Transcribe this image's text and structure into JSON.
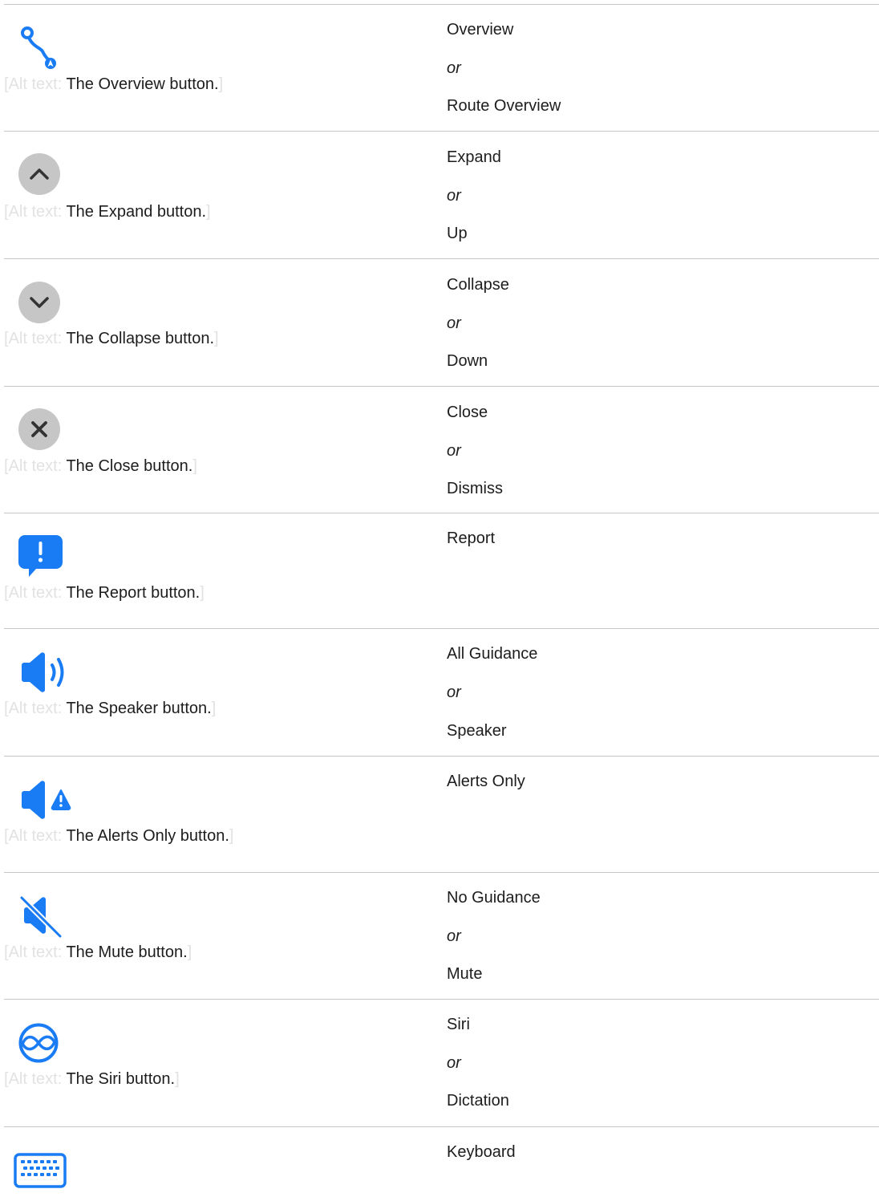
{
  "alt_prefix": "Alt text:",
  "alt_open": "[",
  "alt_close": "]",
  "or_word": "or",
  "accent_color": "#1a7cf4",
  "rows": [
    {
      "icon": "route-overview-icon",
      "alt": "The Overview button.",
      "names": [
        "Overview",
        "Route Overview"
      ]
    },
    {
      "icon": "chevron-up-circle-icon",
      "alt": "The Expand button.",
      "names": [
        "Expand",
        "Up"
      ]
    },
    {
      "icon": "chevron-down-circle-icon",
      "alt": "The Collapse button.",
      "names": [
        "Collapse",
        "Down"
      ]
    },
    {
      "icon": "close-circle-icon",
      "alt": "The Close button.",
      "names": [
        "Close",
        "Dismiss"
      ]
    },
    {
      "icon": "report-bubble-icon",
      "alt": "The Report button.",
      "names": [
        "Report"
      ]
    },
    {
      "icon": "speaker-wave-icon",
      "alt": "The Speaker button.",
      "names": [
        "All Guidance",
        "Speaker"
      ]
    },
    {
      "icon": "speaker-alert-icon",
      "alt": "The Alerts Only button.",
      "names": [
        "Alerts Only"
      ]
    },
    {
      "icon": "speaker-slash-icon",
      "alt": "The Mute button.",
      "names": [
        "No Guidance",
        "Mute"
      ]
    },
    {
      "icon": "siri-icon",
      "alt": "The Siri button.",
      "names": [
        "Siri",
        "Dictation"
      ]
    },
    {
      "icon": "keyboard-icon",
      "alt": "",
      "names": [
        "Keyboard"
      ]
    }
  ]
}
